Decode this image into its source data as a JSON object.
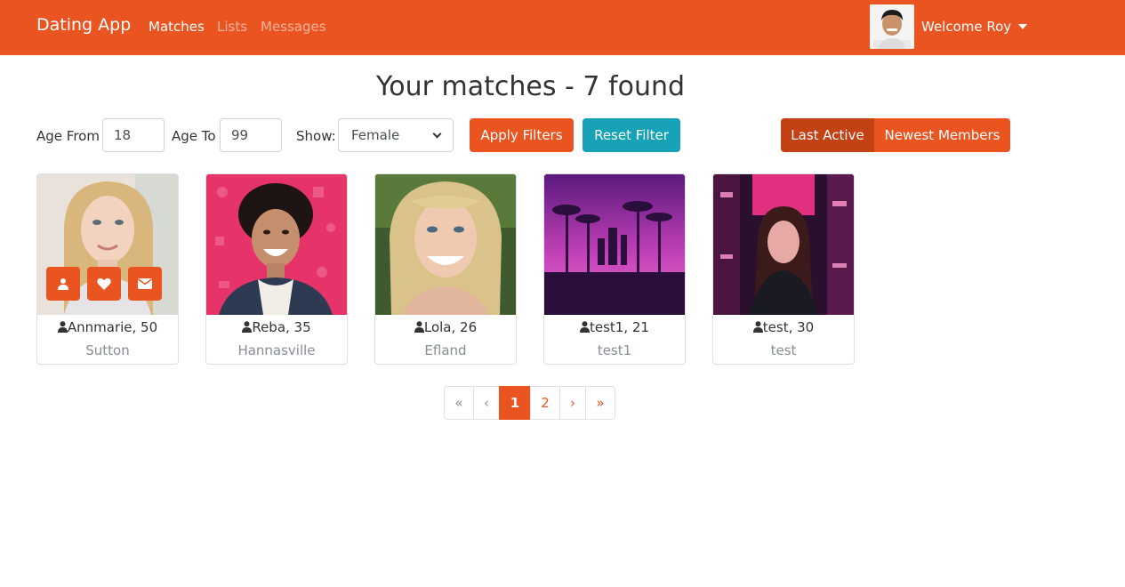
{
  "navbar": {
    "brand": "Dating App",
    "links": [
      "Matches",
      "Lists",
      "Messages"
    ],
    "welcome": "Welcome Roy",
    "color": "#e95420"
  },
  "page_title": "Your matches - 7 found",
  "filters": {
    "age_from_label": "Age From",
    "age_from_value": "18",
    "age_to_label": "Age To",
    "age_to_value": "99",
    "show_label": "Show:",
    "show_value": "Female",
    "apply_label": "Apply Filters",
    "reset_label": "Reset Filter",
    "sort": [
      "Last Active",
      "Newest Members"
    ]
  },
  "members": [
    {
      "name": "Annmarie, 50",
      "city": "Sutton"
    },
    {
      "name": "Reba, 35",
      "city": "Hannasville"
    },
    {
      "name": "Lola, 26",
      "city": "Efland"
    },
    {
      "name": "test1, 21",
      "city": "test1"
    },
    {
      "name": "test, 30",
      "city": "test"
    }
  ],
  "card_actions": [
    "user-icon",
    "heart-icon",
    "envelope-icon"
  ],
  "pagination": {
    "first": "«",
    "prev": "‹",
    "pages": [
      "1",
      "2"
    ],
    "active": "1",
    "next": "›",
    "last": "»"
  }
}
